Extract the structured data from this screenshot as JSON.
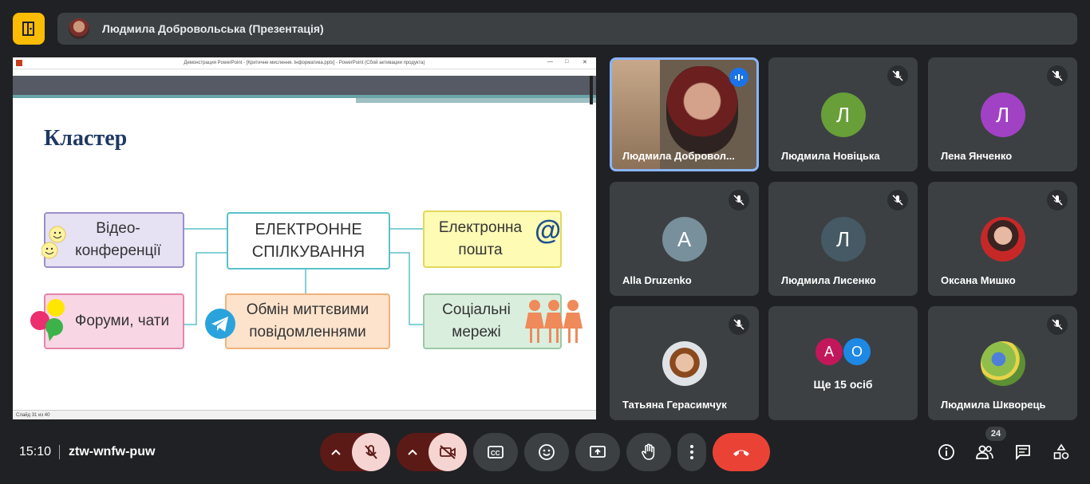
{
  "presenter": {
    "title": "Людмила Добровольська (Презентація)"
  },
  "ppt": {
    "window_title": "Демонстрация PowerPoint - [Критичне мислення. Інформатика.pptx] - PowerPoint (Сбой активации продукта)",
    "status_text": "Слайд 31 из 40"
  },
  "slide": {
    "heading": "Кластер",
    "center": "ЕЛЕКТРОННЕ СПІЛКУВАННЯ",
    "video": "Відео-конференції",
    "forums": "Форуми, чати",
    "messages": "Обмін миттєвими повідомленнями",
    "email": "Електронна пошта",
    "social": "Соціальні мережі",
    "email_symbol": "@"
  },
  "participants": [
    {
      "name": "Людмила Добровол...",
      "initial": "",
      "color": ""
    },
    {
      "name": "Людмила Новіцька",
      "initial": "Л",
      "color": "#689f38"
    },
    {
      "name": "Лена Янченко",
      "initial": "Л",
      "color": "#a142c4"
    },
    {
      "name": "Alla Druzenko",
      "initial": "A",
      "color": "#78909c"
    },
    {
      "name": "Людмила Лисенко",
      "initial": "Л",
      "color": "#455a64"
    },
    {
      "name": "Оксана Мишко",
      "initial": "",
      "color": ""
    },
    {
      "name": "Татьяна Герасимчук",
      "initial": "",
      "color": ""
    },
    {
      "name": "Ще 15 осіб",
      "initial": "",
      "color": ""
    },
    {
      "name": "Людмила Шкворець",
      "initial": "",
      "color": ""
    }
  ],
  "more_avatars": [
    {
      "initial": "A",
      "color": "#c2185b"
    },
    {
      "initial": "O",
      "color": "#1e88e5"
    }
  ],
  "bottom": {
    "time": "15:10",
    "meeting_code": "ztw-wnfw-puw",
    "participant_count": "24"
  },
  "colors": {
    "background": "#202124",
    "tile": "#3c4043",
    "hangup": "#ea4335",
    "active_border": "#8ab4f8",
    "logo": "#fbbc04"
  }
}
